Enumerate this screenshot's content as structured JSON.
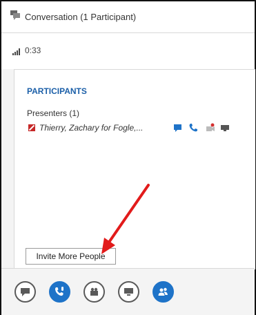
{
  "window": {
    "title": "Conversation (1 Participant)"
  },
  "status": {
    "timer": "0:33",
    "icons": [
      "signal-bars-icon"
    ]
  },
  "participants_panel": {
    "section_title": "PARTICIPANTS",
    "presenters_label": "Presenters (1)",
    "participant": {
      "name": "Thierry, Zachary for Fogle,...",
      "icons": [
        "presenter-flag-icon",
        "chat-icon",
        "phone-icon",
        "video-off-icon",
        "screen-share-icon"
      ]
    },
    "invite_button": {
      "label": "Invite More People"
    }
  },
  "toolbar": {
    "buttons": [
      {
        "name": "im-button",
        "icon": "chat-bubble-icon",
        "active": false
      },
      {
        "name": "audio-button",
        "icon": "phone-mic-icon",
        "active": true
      },
      {
        "name": "video-button",
        "icon": "camera-icon",
        "active": false
      },
      {
        "name": "present-button",
        "icon": "monitor-icon",
        "active": false
      },
      {
        "name": "people-button",
        "icon": "people-icon",
        "active": true
      }
    ]
  },
  "colors": {
    "accent": "#1e73c8",
    "heading": "#1b5fa8",
    "annotation_arrow": "#e21b1b",
    "flag": "#c62828"
  }
}
